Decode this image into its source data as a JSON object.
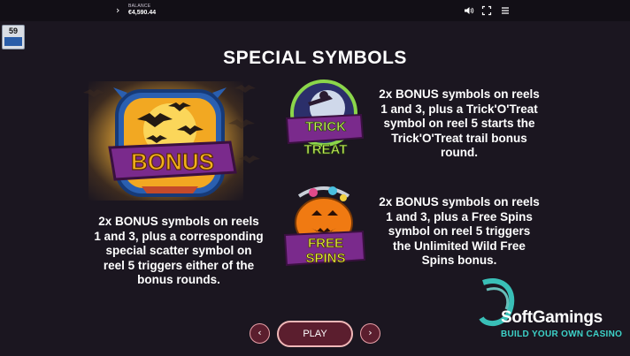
{
  "topbar": {
    "balance_label": "BALANCE",
    "balance_value": "€4,590.44",
    "icons": [
      "chevron-right-icon",
      "speaker-icon",
      "fullscreen-icon",
      "menu-icon"
    ]
  },
  "fps_meter": {
    "value": "59"
  },
  "page": {
    "title": "SPECIAL SYMBOLS"
  },
  "symbols": {
    "bonus": {
      "label": "BONUS",
      "description": "2x BONUS symbols on reels 1 and 3, plus a corresponding special scatter symbol on reel 5 triggers either of the bonus rounds."
    },
    "trick_or_treat": {
      "label_line1": "TRICK",
      "label_line2": "TREAT",
      "description": "2x BONUS symbols on reels 1 and 3, plus a Trick'O'Treat symbol on reel 5 starts the Trick'O'Treat trail bonus round."
    },
    "free_spins": {
      "label_line1": "FREE",
      "label_line2": "SPINS",
      "description": "2x BONUS symbols on reels 1 and 3, plus a Free Spins symbol on reel 5 triggers the Unlimited Wild Free Spins bonus."
    }
  },
  "nav": {
    "play_label": "PLAY",
    "prev_icon": "chevron-left-icon",
    "next_icon": "chevron-right-icon"
  },
  "watermark": {
    "brand": "SoftGamings",
    "tagline": "BUILD YOUR OWN CASINO"
  },
  "colors": {
    "background": "#1b1620",
    "button_fill": "#5b1e2e",
    "bonus_text": "#f2b11c",
    "brand_accent": "#3dd2c8"
  }
}
